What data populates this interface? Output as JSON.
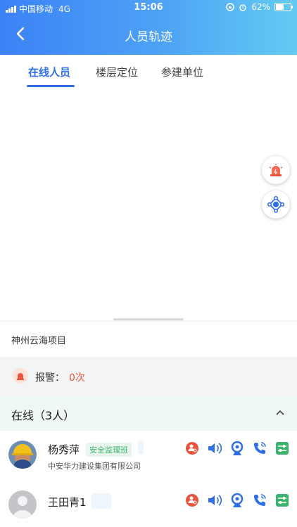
{
  "status": {
    "carrier": "中国移动",
    "network": "4G",
    "time": "15:06",
    "battery": "62%",
    "battery_level": 0.62
  },
  "nav": {
    "title": "人员轨迹"
  },
  "tabs": [
    {
      "label": "在线人员",
      "active": true
    },
    {
      "label": "楼层定位",
      "active": false
    },
    {
      "label": "参建单位",
      "active": false
    }
  ],
  "project": {
    "name": "神州云海项目"
  },
  "alarm": {
    "label": "报警：",
    "count": "0次"
  },
  "online": {
    "label": "在线（3人）"
  },
  "people": [
    {
      "name": "杨秀萍",
      "team": "安全监理班",
      "company": "中安华力建设集团有限公司"
    },
    {
      "name": "王田青1",
      "team": "",
      "company": ""
    }
  ],
  "colors": {
    "primary": "#2e6ee6",
    "alarm": "#e05a3a",
    "green": "#3bb36c"
  }
}
